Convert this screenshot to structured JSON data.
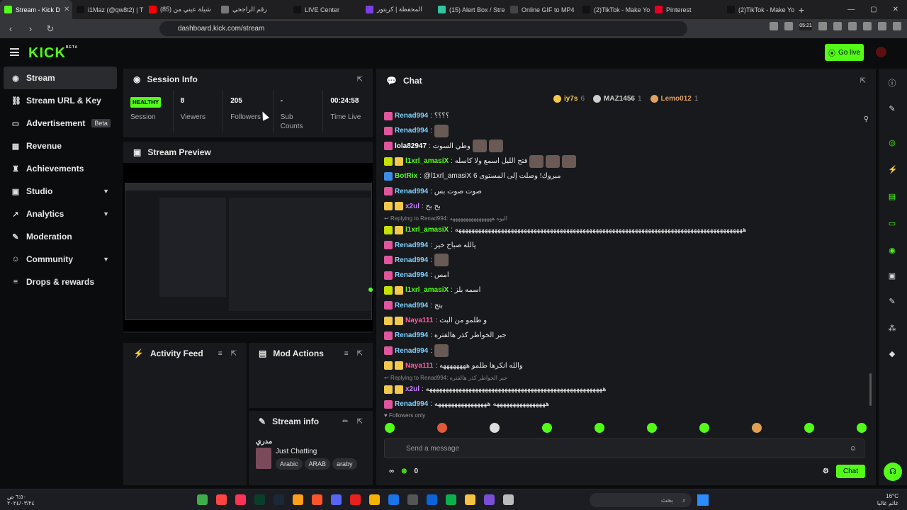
{
  "browser": {
    "tabs": [
      {
        "label": "Stream - Kick D",
        "color": "#53fc18",
        "active": true
      },
      {
        "label": "i1Maz (@qw8t2) | T",
        "color": "#111111"
      },
      {
        "label": "(85) شيلة عيني من",
        "color": "#ff0000"
      },
      {
        "label": "رقم الراجحي",
        "color": "#777777"
      },
      {
        "label": "LIVE Center",
        "color": "#111111"
      },
      {
        "label": "المحفظة | كريتور",
        "color": "#7b3fe4"
      },
      {
        "label": "(15) Alert Box / Stre",
        "color": "#31c3a2"
      },
      {
        "label": "Online GIF to MP4",
        "color": "#444444"
      },
      {
        "label": "(2)TikTok - Make Yo",
        "color": "#111111"
      },
      {
        "label": "Pinterest",
        "color": "#e60023"
      },
      {
        "label": "(2)TikTok - Make Yo",
        "color": "#111111"
      }
    ],
    "url": "dashboard.kick.com/stream",
    "ext_time": "05:21"
  },
  "topnav": {
    "logo": "KICK",
    "logo_sup": "BETA",
    "go_live": "Go live"
  },
  "sidebar": {
    "items": [
      {
        "label": "Stream",
        "icon": "stream-icon",
        "glyph": "◉",
        "active": true
      },
      {
        "label": "Stream URL & Key",
        "icon": "link-icon",
        "glyph": "⛓"
      },
      {
        "label": "Advertisement",
        "icon": "ad-icon",
        "glyph": "▭",
        "badge": "Beta"
      },
      {
        "label": "Revenue",
        "icon": "revenue-icon",
        "glyph": "▦"
      },
      {
        "label": "Achievements",
        "icon": "trophy-icon",
        "glyph": "♜"
      },
      {
        "label": "Studio",
        "icon": "studio-icon",
        "glyph": "▣",
        "chevron": true
      },
      {
        "label": "Analytics",
        "icon": "analytics-icon",
        "glyph": "↗",
        "chevron": true
      },
      {
        "label": "Moderation",
        "icon": "wrench-icon",
        "glyph": "✎"
      },
      {
        "label": "Community",
        "icon": "community-icon",
        "glyph": "☺",
        "chevron": true
      },
      {
        "label": "Drops & rewards",
        "icon": "drops-icon",
        "glyph": "≡"
      }
    ]
  },
  "session": {
    "title": "Session Info",
    "status": "HEALTHY",
    "status_label": "Session",
    "viewers": "8",
    "viewers_label": "Viewers",
    "followers": "205",
    "followers_label": "Followers",
    "subs": "-",
    "subs_label": "Sub Counts",
    "time": "00:24:58",
    "time_label": "Time Live"
  },
  "preview": {
    "title": "Stream Preview"
  },
  "activity": {
    "title": "Activity Feed"
  },
  "modactions": {
    "title": "Mod Actions"
  },
  "streaminfo": {
    "title": "Stream info",
    "stream_title": "مدري",
    "category": "Just Chatting",
    "tags": [
      "Arabic",
      "ARAB",
      "araby"
    ]
  },
  "chat": {
    "title": "Chat",
    "leaderboard": [
      {
        "name": "iy7s",
        "count": "6",
        "color": "#f2c94c"
      },
      {
        "name": "MAZ1456",
        "count": "1",
        "color": "#cfcfcf"
      },
      {
        "name": "Lemo012",
        "count": "1",
        "color": "#e0a060"
      }
    ],
    "messages": [
      {
        "user": "Renad994",
        "color": "#7fd0ff",
        "badge": "#e0559b",
        "text": ": ؟؟؟؟"
      },
      {
        "user": "Renad994",
        "color": "#7fd0ff",
        "badge": "#e0559b",
        "text": ":",
        "emote": true
      },
      {
        "user": "lola82947",
        "color": "#ffffff",
        "badge": "#e0559b",
        "text": ": وطي السوت",
        "emotes": 2
      },
      {
        "user": "l1xrl_amasiX",
        "color": "#53fc18",
        "badge": "#c6e000",
        "text": ": فتح الليل اسمع ولا كاسله",
        "emotes": 3
      },
      {
        "user": "BotRix",
        "color": "#53fc18",
        "badge": "#3a8ee6",
        "text": ": @l1xrl_amasiX مبروك! وصلت إلى المستوى 6"
      },
      {
        "user": "Renad994",
        "color": "#7fd0ff",
        "badge": "#e0559b",
        "text": ": صوت صوت بس"
      },
      {
        "user": "x2ul",
        "color": "#c77dff",
        "badge": "#f2c94c",
        "text": ": بح بح"
      },
      {
        "reply": "Replying to Renad994: اليوه ههههههههههههههههه"
      },
      {
        "user": "l1xrl_amasiX",
        "color": "#53fc18",
        "badge": "#c6e000",
        "text": ": ههههههههههههههههههههههههههههههههههههههههههههههههههههههههههههههههههههههههههههههههههههههههه"
      },
      {
        "user": "Renad994",
        "color": "#7fd0ff",
        "badge": "#e0559b",
        "text": ": يالله صباح خير"
      },
      {
        "user": "Renad994",
        "color": "#7fd0ff",
        "badge": "#e0559b",
        "text": ":",
        "emote": true
      },
      {
        "user": "Renad994",
        "color": "#7fd0ff",
        "badge": "#e0559b",
        "text": ": امس"
      },
      {
        "user": "l1xrl_amasiX",
        "color": "#53fc18",
        "badge": "#c6e000",
        "text": ": اسمه بلز"
      },
      {
        "user": "Renad994",
        "color": "#7fd0ff",
        "badge": "#e0559b",
        "text": ": بنج"
      },
      {
        "user": "Naya111",
        "color": "#ff5aa5",
        "badge": "#f2c94c",
        "text": ": و طلمو من البث"
      },
      {
        "user": "Renad994",
        "color": "#7fd0ff",
        "badge": "#e0559b",
        "text": ": جبر الخواطر كذر هالفتره"
      },
      {
        "user": "Renad994",
        "color": "#7fd0ff",
        "badge": "#e0559b",
        "text": ":",
        "emote": true
      },
      {
        "user": "Naya111",
        "color": "#ff5aa5",
        "badge": "#f2c94c",
        "text": ": والله انكرها طلمو ههههههههه"
      },
      {
        "reply": "Replying to Renad994: جبر الخواطر كذر هالفتره"
      },
      {
        "user": "x2ul",
        "color": "#c77dff",
        "badge": "#f2c94c",
        "text": ": ههههههههههههههههههههههههههههههههههههههههههههههههههههههه"
      },
      {
        "user": "Renad994",
        "color": "#7fd0ff",
        "badge": "#e0559b",
        "text": ": ههههههههههههههههه ههههههههههههههههه"
      }
    ],
    "followers_only": "Followers only",
    "input_placeholder": "Send a message",
    "points": "0",
    "send": "Chat"
  },
  "taskbar": {
    "time": "٦:٥٠ ص",
    "date": "٢٠٢٤/٠٣/٢٤",
    "search": "بحث",
    "temp": "16°C",
    "weather": "غائم غالبا"
  }
}
